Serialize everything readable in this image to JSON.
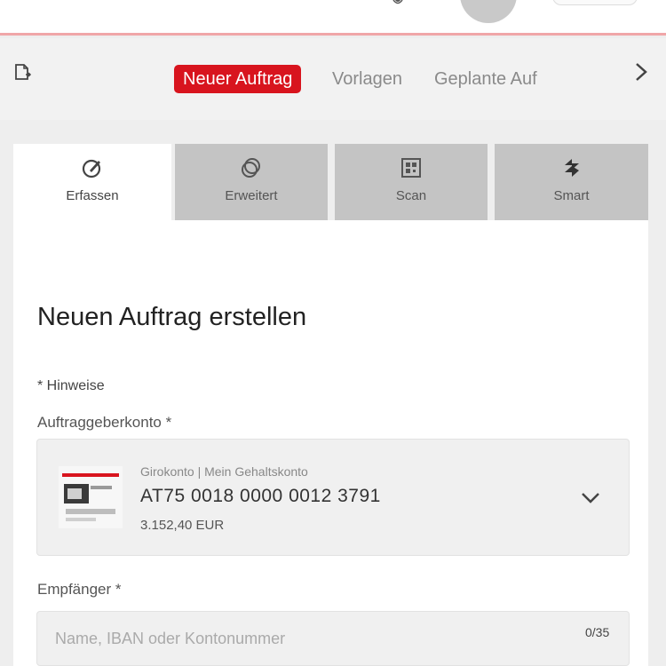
{
  "header": {
    "brand_prefix": "",
    "brand": "",
    "colors": {
      "accent": "#d8141e",
      "divider": "#f0a6a8"
    }
  },
  "subnav": {
    "tabs": [
      {
        "label": "Neuer Auftrag",
        "active": true
      },
      {
        "label": "Vorlagen",
        "active": false
      },
      {
        "label": "Geplante Auf",
        "active": false
      }
    ]
  },
  "modes": [
    {
      "label": "Erfassen",
      "icon": "edit-icon",
      "active": true
    },
    {
      "label": "Erweitert",
      "icon": "copy-icon",
      "active": false
    },
    {
      "label": "Scan",
      "icon": "scan-icon",
      "active": false
    },
    {
      "label": "Smart",
      "icon": "smart-icon",
      "active": false
    }
  ],
  "form": {
    "title": "Neuen Auftrag erstellen",
    "hint": "* Hinweise",
    "account_label": "Auftraggeberkonto *",
    "account": {
      "name": "Girokonto | Mein Gehaltskonto",
      "iban": "AT75 0018 0000 0012 3791",
      "balance": "3.152,40 EUR"
    },
    "recipient_label": "Empfänger *",
    "recipient_placeholder": "Name, IBAN oder Kontonummer",
    "recipient_value": "",
    "recipient_counter": "0/35"
  }
}
